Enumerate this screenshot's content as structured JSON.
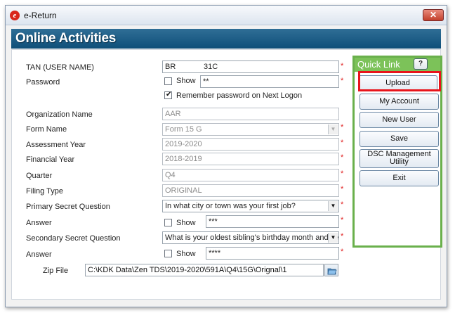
{
  "window": {
    "title": "e-Return",
    "close_glyph": "✕"
  },
  "banner": {
    "title": "Online Activities"
  },
  "form": {
    "tan": {
      "label": "TAN (USER NAME)",
      "value": "BR             31C"
    },
    "password": {
      "label": "Password",
      "show_label": "Show",
      "value": "**"
    },
    "remember": {
      "label": "Remember password on Next Logon",
      "checked": true
    },
    "organization": {
      "label": "Organization Name",
      "value": "AAR"
    },
    "form_name": {
      "label": "Form Name",
      "value": "Form 15 G"
    },
    "assessment_year": {
      "label": "Assessment Year",
      "value": "2019-2020"
    },
    "financial_year": {
      "label": "Financial Year",
      "value": "2018-2019"
    },
    "quarter": {
      "label": "Quarter",
      "value": "Q4"
    },
    "filing_type": {
      "label": "Filing Type",
      "value": "ORIGINAL"
    },
    "primary_question": {
      "label": "Primary Secret Question",
      "value": "In what city or town was your first job?"
    },
    "answer1": {
      "label": "Answer",
      "show_label": "Show",
      "value": "***"
    },
    "secondary_question": {
      "label": "Secondary Secret Question",
      "value": "What is your oldest sibling's birthday month and year"
    },
    "answer2": {
      "label": "Answer",
      "show_label": "Show",
      "value": "****"
    },
    "zip_file": {
      "label": "Zip File",
      "value": "C:\\KDK Data\\Zen TDS\\2019-2020\\591A\\Q4\\15G\\Orignal\\1"
    },
    "required_mark": "*"
  },
  "quick_link": {
    "title": "Quick Link",
    "help_label": "?",
    "buttons": {
      "upload": "Upload",
      "my_account": "My Account",
      "new_user": "New User",
      "save": "Save",
      "dsc": "DSC Management Utility",
      "exit": "Exit"
    }
  },
  "icons": [
    "app-logo-icon",
    "close-icon",
    "dropdown-arrow-icon",
    "folder-open-icon",
    "checkbox-icon"
  ],
  "colors": {
    "banner": "#0f4f79",
    "quick_link_border": "#6ab04c",
    "highlight": "#e8141b",
    "required": "#e02020"
  }
}
